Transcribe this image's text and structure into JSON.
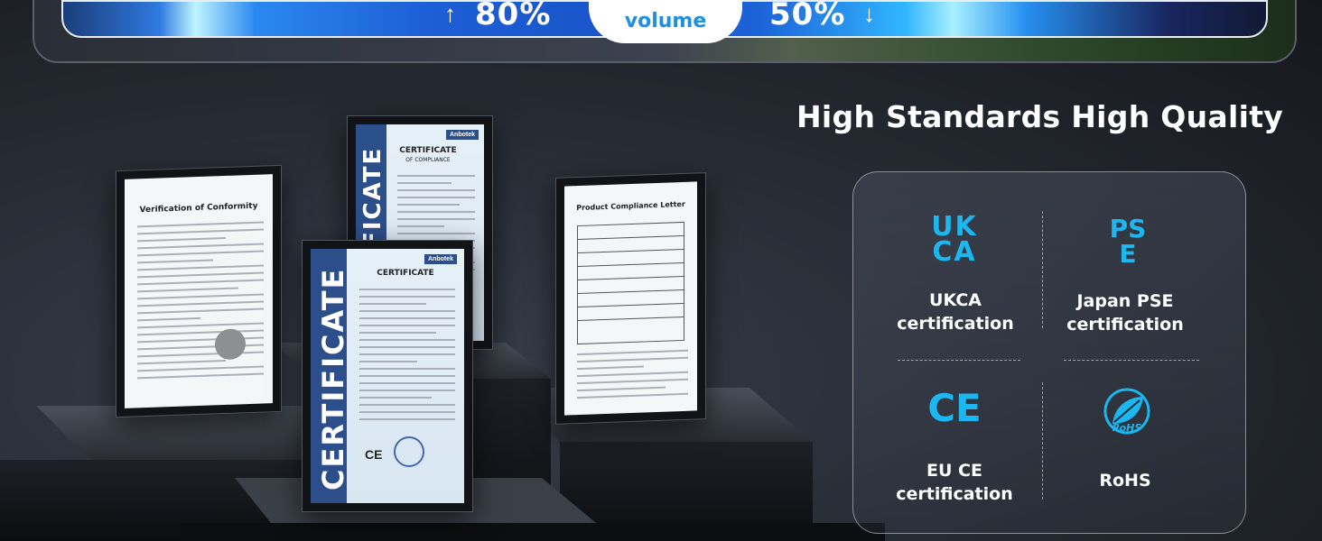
{
  "banner": {
    "left_value": "80%",
    "right_value": "50%",
    "pill_label": "volume",
    "up_arrow": "↑",
    "down_arrow": "↓"
  },
  "headline": "High Standards High Quality",
  "certifications": [
    {
      "logo": "UKCA",
      "label_line1": "UKCA",
      "label_line2": "certification",
      "icon": "ukca-mark-icon"
    },
    {
      "logo": "PSE",
      "label_line1": "Japan PSE",
      "label_line2": "certification",
      "icon": "pse-mark-icon"
    },
    {
      "logo": "CE",
      "label_line1": "EU CE",
      "label_line2": "certification",
      "icon": "ce-mark-icon"
    },
    {
      "logo": "RoHS",
      "label_line1": "RoHS",
      "label_line2": "",
      "icon": "rohs-leaf-icon"
    }
  ],
  "documents": {
    "doc1_title": "Verification of Conformity",
    "doc2_band": "CERTIFICATE",
    "doc2_title": "CERTIFICATE",
    "doc2_subtitle": "OF COMPLIANCE",
    "doc2_brand": "Anbotek",
    "doc3_title": "Product Compliance Letter",
    "doc4_band": "CERTIFICATE",
    "doc4_title": "CERTIFICATE",
    "doc4_brand": "Anbotek",
    "ce_mark": "CE"
  },
  "colors": {
    "accent": "#1cb6f0",
    "band_blue": "#2c4f8c",
    "volume_text": "#1f8fe0"
  }
}
